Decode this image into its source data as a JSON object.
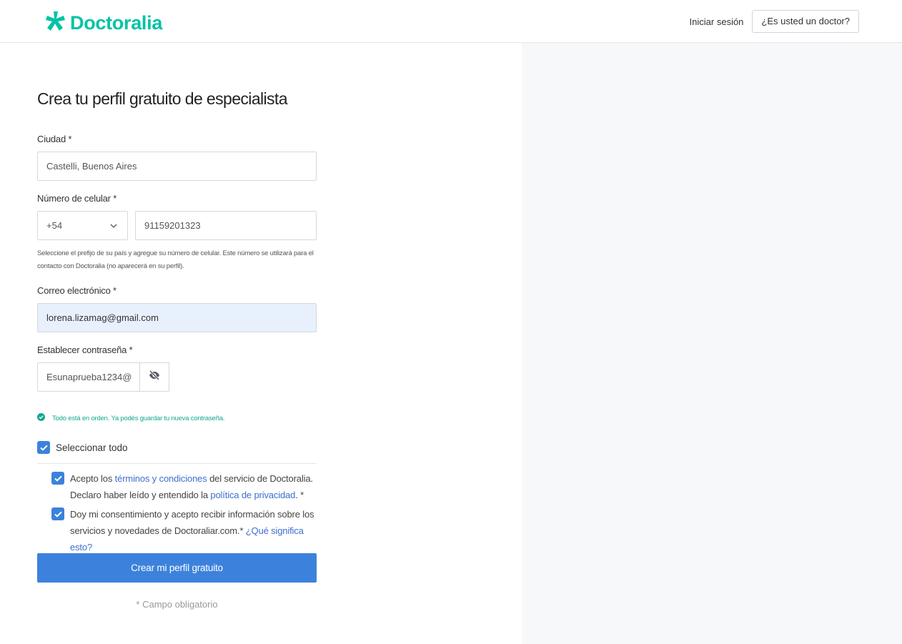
{
  "header": {
    "logo_text": "Doctoralia",
    "login_label": "Iniciar sesión",
    "doctor_button_label": "¿Es usted un doctor?"
  },
  "form": {
    "title": "Crea tu perfil gratuito de especialista",
    "city": {
      "label": "Ciudad *",
      "value": "Castelli, Buenos Aires"
    },
    "phone": {
      "label": "Número de celular *",
      "prefix": "+54",
      "number": "91159201323",
      "hint": "Seleccione el prefijo de su país y agregue su número de celular. Este número se utilizará para el contacto con Doctoralia (no aparecerá en su perfil)."
    },
    "email": {
      "label": "Correo electrónico *",
      "value": "lorena.lizamag@gmail.com"
    },
    "password": {
      "label": "Establecer contraseña *",
      "value": "Esunaprueba1234@",
      "success_message": "Todo está en orden. Ya podés guardar tu nueva contraseña."
    },
    "select_all": {
      "label": "Seleccionar todo",
      "checked": true
    },
    "terms": {
      "text_before": "Acepto los ",
      "link1": "términos y condiciones",
      "text_middle": " del servicio de Doctoralia. Declaro haber leído y entendido la ",
      "link2": "política de privacidad",
      "text_after": ". *",
      "checked": true
    },
    "marketing": {
      "text": "Doy mi consentimiento y acepto recibir información sobre los servicios y novedades de Doctoraliar.com.* ",
      "link": "¿Qué significa esto?",
      "checked": true
    },
    "submit_label": "Crear mi perfil gratuito",
    "required_note": "* Campo obligatorio"
  },
  "colors": {
    "brand": "#00c3a5",
    "primary": "#3c82dc",
    "link": "#3c6fce",
    "success": "#13a88e",
    "autofill_bg": "#e8f0fe"
  }
}
